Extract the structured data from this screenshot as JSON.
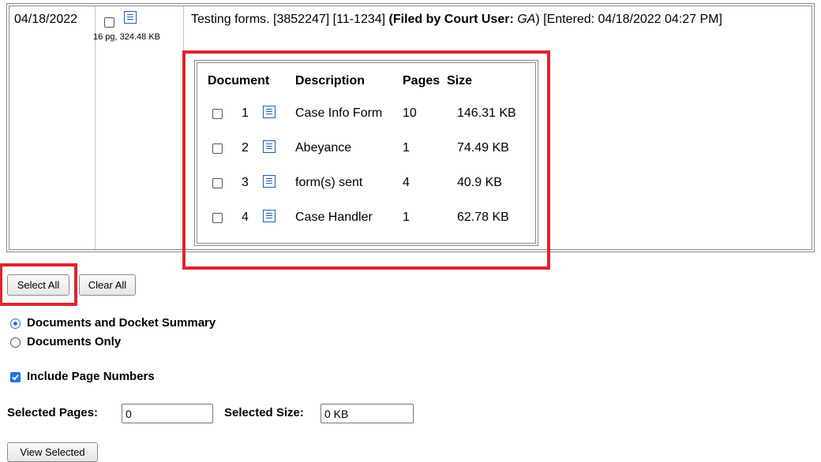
{
  "entry": {
    "date": "04/18/2022",
    "meta": "16 pg, 324.48 KB",
    "text_prefix": "Testing forms. [3852247] [11-1234]",
    "filed_by_label": "(Filed by Court User:",
    "filed_by_user": "GA",
    "filed_by_close": ")",
    "entered": "[Entered: 04/18/2022 04:27 PM]"
  },
  "documents_table": {
    "headers": {
      "document": "Document",
      "description": "Description",
      "pages": "Pages",
      "size": "Size"
    },
    "rows": [
      {
        "num": "1",
        "description": "Case Info Form",
        "pages": "10",
        "size": "146.31 KB"
      },
      {
        "num": "2",
        "description": "Abeyance",
        "pages": "1",
        "size": "74.49 KB"
      },
      {
        "num": "3",
        "description": "form(s) sent",
        "pages": "4",
        "size": "40.9 KB"
      },
      {
        "num": "4",
        "description": "Case Handler",
        "pages": "1",
        "size": "62.78 KB"
      }
    ]
  },
  "buttons": {
    "select_all": "Select All",
    "clear_all": "Clear All",
    "view_selected": "View Selected"
  },
  "options": {
    "radio_docs_and_summary": "Documents and Docket Summary",
    "radio_docs_only": "Documents Only",
    "include_page_numbers": "Include Page Numbers"
  },
  "totals": {
    "selected_pages_label": "Selected Pages:",
    "selected_pages_value": "0",
    "selected_size_label": "Selected Size:",
    "selected_size_value": "0 KB"
  },
  "colors": {
    "highlight": "#e0242c",
    "accent": "#1a73e8",
    "icon": "#1a5fb4"
  },
  "icons": {
    "document": "document-icon",
    "check": "check-icon"
  }
}
